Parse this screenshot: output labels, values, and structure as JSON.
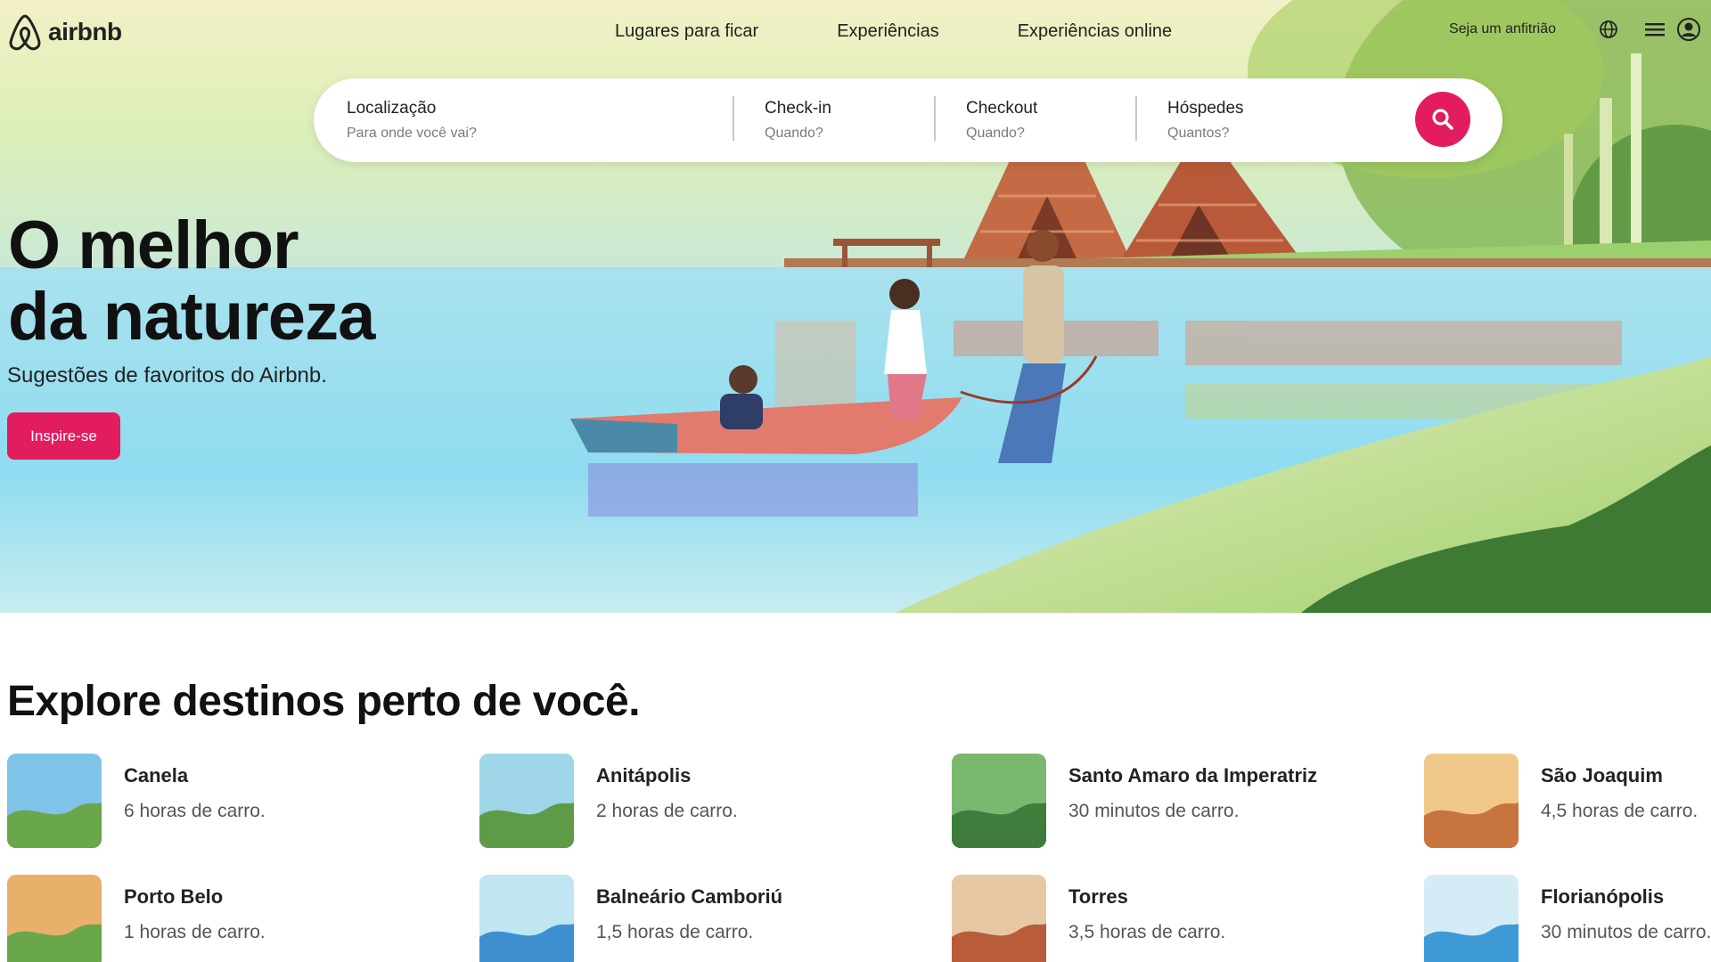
{
  "brand": {
    "name": "airbnb",
    "accent": "#e31c5f"
  },
  "nav": {
    "links": [
      "Lugares para ficar",
      "Experiências",
      "Experiências online"
    ],
    "host_label": "Seja um anfitrião",
    "icons": [
      "globe-icon",
      "menu-icon",
      "user-icon"
    ]
  },
  "search": {
    "fields": [
      {
        "label": "Localização",
        "placeholder": "Para onde você vai?"
      },
      {
        "label": "Check-in",
        "placeholder": "Quando?"
      },
      {
        "label": "Checkout",
        "placeholder": "Quando?"
      },
      {
        "label": "Hóspedes",
        "placeholder": "Quantos?"
      }
    ],
    "button_icon": "search-icon"
  },
  "hero": {
    "title_line1": "O melhor",
    "title_line2": "da natureza",
    "subtitle": "Sugestões de favoritos do Airbnb.",
    "cta": "Inspire-se"
  },
  "explore": {
    "title": "Explore destinos perto de você.",
    "destinations": [
      {
        "name": "Canela",
        "distance": "6 horas de carro.",
        "colors": [
          "#7fc4e8",
          "#6aa64a"
        ]
      },
      {
        "name": "Anitápolis",
        "distance": "2 horas de carro.",
        "colors": [
          "#9fd7e8",
          "#5f9a46"
        ]
      },
      {
        "name": "Santo Amaro da Imperatriz",
        "distance": "30 minutos de carro.",
        "colors": [
          "#7ab870",
          "#3f7d3c"
        ]
      },
      {
        "name": "São Joaquim",
        "distance": "4,5 horas de carro.",
        "colors": [
          "#f0c88a",
          "#c8743e"
        ]
      },
      {
        "name": "Porto Belo",
        "distance": "1 horas de carro.",
        "colors": [
          "#e8b06a",
          "#6aa64a"
        ]
      },
      {
        "name": "Balneário Camboriú",
        "distance": "1,5 horas de carro.",
        "colors": [
          "#bfe6f2",
          "#3e8fd0"
        ]
      },
      {
        "name": "Torres",
        "distance": "3,5 horas de carro.",
        "colors": [
          "#e6c8a4",
          "#b85c3a"
        ]
      },
      {
        "name": "Florianópolis",
        "distance": "30 minutos de carro.",
        "colors": [
          "#d4ecf5",
          "#3e9ad6"
        ]
      }
    ]
  }
}
